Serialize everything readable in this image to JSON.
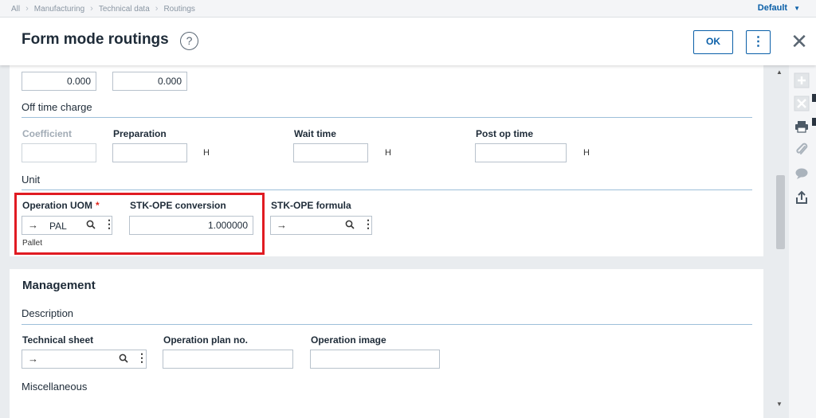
{
  "breadcrumb": [
    "All",
    "Manufacturing",
    "Technical data",
    "Routings"
  ],
  "top_menu": {
    "label": "Default"
  },
  "header": {
    "title": "Form mode routings",
    "help": "?",
    "ok_label": "OK"
  },
  "top_fields": {
    "value1": "0.000",
    "value2": "0.000"
  },
  "off_time": {
    "section_label": "Off time charge",
    "coefficient_label": "Coefficient",
    "preparation_label": "Preparation",
    "wait_time_label": "Wait time",
    "post_op_time_label": "Post op time",
    "unit_suffix": "H"
  },
  "unit": {
    "section_label": "Unit",
    "operation_uom_label": "Operation UOM",
    "operation_uom_value": "PAL",
    "operation_uom_desc": "Pallet",
    "stk_ope_conversion_label": "STK-OPE conversion",
    "stk_ope_conversion_value": "1.000000",
    "stk_ope_formula_label": "STK-OPE formula"
  },
  "management": {
    "title": "Management",
    "description_label": "Description",
    "technical_sheet_label": "Technical sheet",
    "operation_plan_label": "Operation plan no.",
    "operation_image_label": "Operation image",
    "misc_label": "Miscellaneous"
  },
  "icons": {
    "lookup_arrow": "arrow-right-icon",
    "lookup_search": "search-icon",
    "lookup_more": "vertical-dots-icon",
    "side": [
      "plus-icon",
      "delete-icon",
      "print-icon",
      "paperclip-icon",
      "comment-icon",
      "share-icon"
    ]
  },
  "colors": {
    "accent": "#0a5fa8",
    "highlight": "#e01b22",
    "required": "#e0271d"
  }
}
